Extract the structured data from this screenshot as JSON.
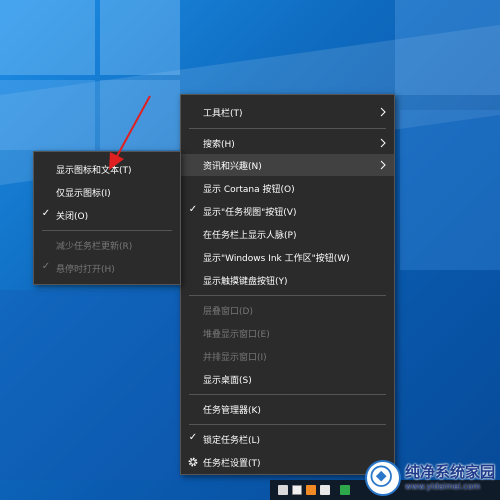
{
  "main_menu": {
    "items": [
      {
        "label": "工具栏(T)",
        "submenu": true
      },
      {
        "label": "搜索(H)",
        "submenu": true
      },
      {
        "label": "资讯和兴趣(N)",
        "submenu": true
      },
      {
        "label": "显示 Cortana 按钮(O)"
      },
      {
        "label": "显示\"任务视图\"按钮(V)",
        "checked": true
      },
      {
        "label": "在任务栏上显示人脉(P)"
      },
      {
        "label": "显示\"Windows Ink 工作区\"按钮(W)"
      },
      {
        "label": "显示触摸键盘按钮(Y)"
      },
      {
        "label": "层叠窗口(D)",
        "disabled": true
      },
      {
        "label": "堆叠显示窗口(E)",
        "disabled": true
      },
      {
        "label": "并排显示窗口(I)",
        "disabled": true
      },
      {
        "label": "显示桌面(S)"
      },
      {
        "label": "任务管理器(K)"
      },
      {
        "label": "锁定任务栏(L)",
        "checked": true
      },
      {
        "label": "任务栏设置(T)",
        "icon": "gear-icon"
      }
    ]
  },
  "sub_menu": {
    "items": [
      {
        "label": "显示图标和文本(T)"
      },
      {
        "label": "仅显示图标(I)"
      },
      {
        "label": "关闭(O)",
        "checked": true
      },
      {
        "label": "减少任务栏更新(R)",
        "disabled": true
      },
      {
        "label": "悬停时打开(H)",
        "checked": true,
        "disabled": true
      }
    ]
  },
  "check_glyph": "✓",
  "watermark": {
    "title": "纯净系统家园",
    "url": "www.yidaimei.com"
  },
  "colors": {
    "menu_bg": "#2b2b2b",
    "menu_hover": "#414141",
    "disabled_text": "#777777",
    "arrow_red": "#e02020"
  }
}
